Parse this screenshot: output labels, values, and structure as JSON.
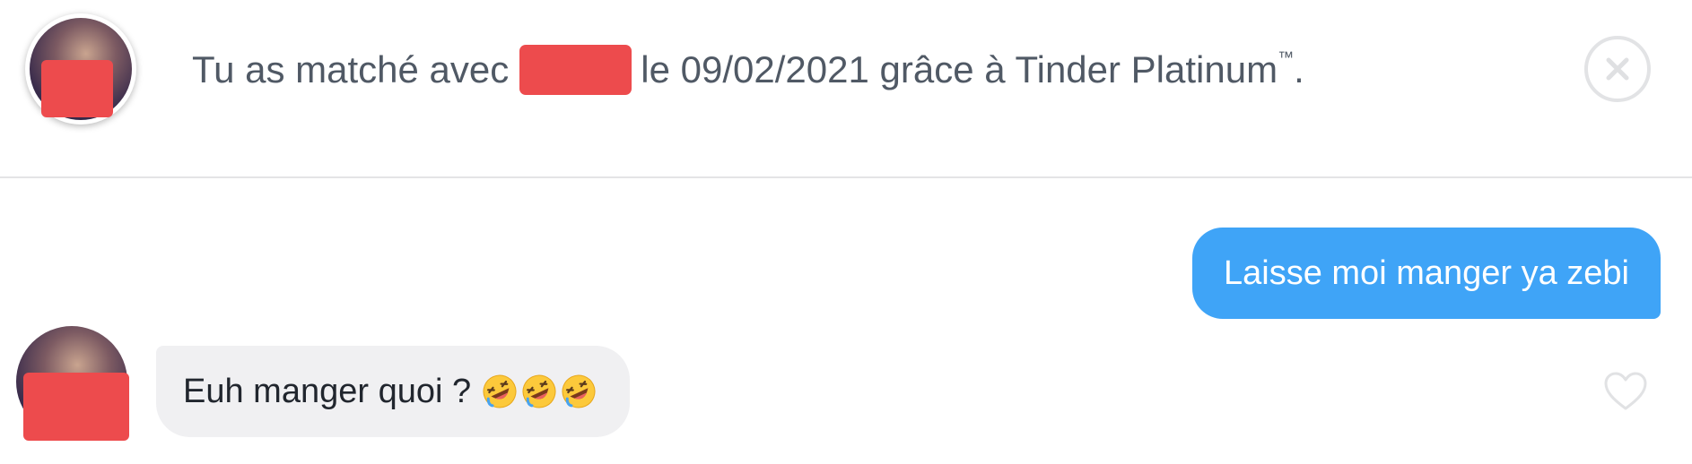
{
  "match_notice": {
    "prefix": "Tu as matché avec",
    "suffix": "le 09/02/2021 grâce à Tinder Platinum",
    "trademark": "™",
    "end": "."
  },
  "messages": [
    {
      "direction": "sent",
      "text": "Laisse moi manger ya zebi"
    },
    {
      "direction": "received",
      "text": "Euh manger quoi ?",
      "emojis": [
        "rolling-on-the-floor-laughing",
        "rolling-on-the-floor-laughing",
        "rolling-on-the-floor-laughing"
      ]
    }
  ],
  "icons": {
    "close": "close-icon",
    "like": "heart-icon"
  },
  "colors": {
    "sent_bubble": "#3fa4f7",
    "received_bubble": "#f0f0f2",
    "redaction": "#ed4b4d",
    "header_text": "#505965",
    "divider": "#e4e4e6"
  }
}
